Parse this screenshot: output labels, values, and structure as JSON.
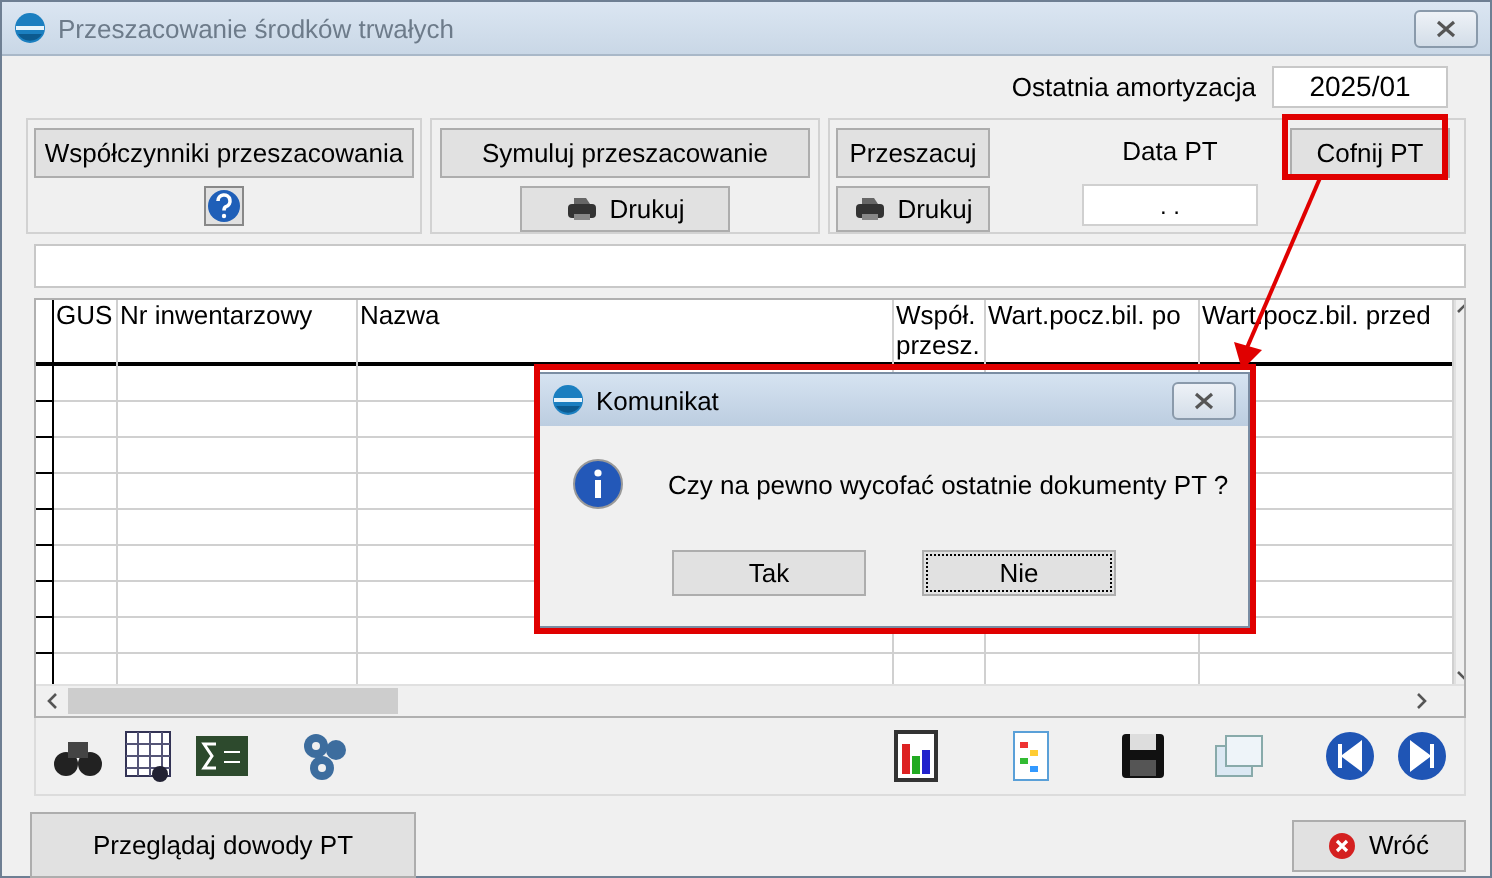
{
  "window": {
    "title": "Przeszacowanie środków trwałych"
  },
  "last_depreciation": {
    "label": "Ostatnia amortyzacja",
    "value": "2025/01"
  },
  "groups": [
    {
      "button": "Współczynniki  przeszacowania",
      "secondary": {
        "kind": "help"
      }
    },
    {
      "button": "Symuluj przeszacowanie",
      "secondary": {
        "kind": "print",
        "label": "Drukuj"
      }
    },
    {
      "button": "Przeszacuj",
      "secondary": {
        "kind": "print",
        "label": "Drukuj"
      },
      "date_label": "Data PT",
      "date_value": ". .",
      "undo": "Cofnij  PT"
    }
  ],
  "table": {
    "columns": [
      "GUS",
      "Nr inwentarzowy",
      "Nazwa",
      "Współ. przesz.",
      "Wart.pocz.bil. po",
      "Wart.pocz.bil. przed"
    ]
  },
  "footer": {
    "browse": "Przeglądaj dowody PT",
    "back": "Wróć"
  },
  "dialog": {
    "title": "Komunikat",
    "message": "Czy na pewno wycofać ostatnie dokumenty PT ?",
    "buttons": [
      {
        "label": "Tak",
        "focused": false
      },
      {
        "label": "Nie",
        "focused": true
      }
    ]
  }
}
